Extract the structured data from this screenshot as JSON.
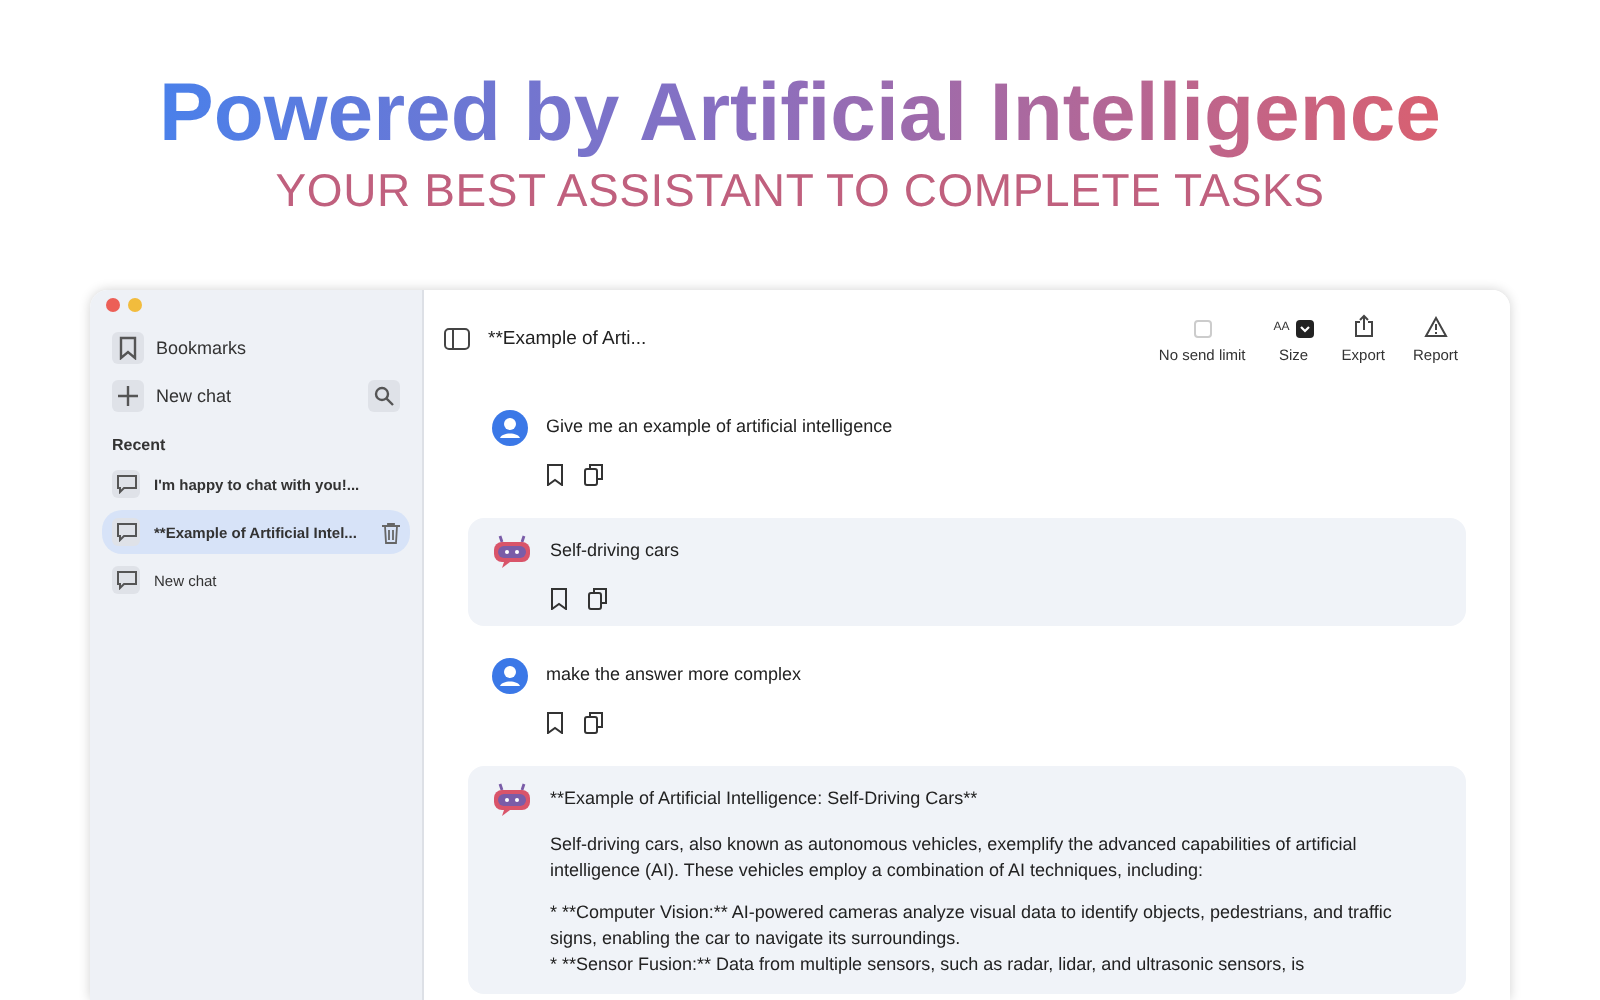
{
  "headline": "Powered by Artificial Intelligence",
  "subtitle": "YOUR BEST ASSISTANT TO COMPLETE TASKS",
  "sidebar": {
    "bookmarks": "Bookmarks",
    "new_chat": "New chat",
    "section": "Recent",
    "items": [
      {
        "label": "I'm happy to chat with you!...",
        "selected": false
      },
      {
        "label": "**Example of Artificial Intel...",
        "selected": true
      },
      {
        "label": "New chat",
        "selected": false
      }
    ]
  },
  "toolbar": {
    "title": "**Example of Arti...",
    "no_send_limit": {
      "label": "No send limit",
      "checked": false
    },
    "size": {
      "label": "Size",
      "glyph": "AA"
    },
    "export": "Export",
    "report": "Report"
  },
  "messages": [
    {
      "kind": "user",
      "paragraphs": [
        {
          "kind": "paragraph",
          "text": "Give me an example of artificial intelligence"
        }
      ]
    },
    {
      "kind": "bot",
      "paragraphs": [
        {
          "kind": "paragraph",
          "text": "Self-driving cars"
        }
      ]
    },
    {
      "kind": "user",
      "paragraphs": [
        {
          "kind": "paragraph",
          "text": "make the answer more complex"
        }
      ]
    },
    {
      "kind": "bot",
      "paragraphs": [
        {
          "kind": "paragraph",
          "text": "**Example of Artificial Intelligence: Self-Driving Cars**"
        },
        {
          "kind": "paragraph",
          "text": "Self-driving cars, also known as autonomous vehicles, exemplify the advanced capabilities of artificial intelligence (AI). These vehicles employ a combination of AI techniques, including:"
        },
        {
          "kind": "bullet",
          "text": "* **Computer Vision:** AI-powered cameras analyze visual data to identify objects, pedestrians, and traffic signs, enabling the car to navigate its surroundings."
        },
        {
          "kind": "bullet",
          "text": "* **Sensor Fusion:** Data from multiple sensors, such as radar, lidar, and ultrasonic sensors, is"
        }
      ]
    }
  ]
}
